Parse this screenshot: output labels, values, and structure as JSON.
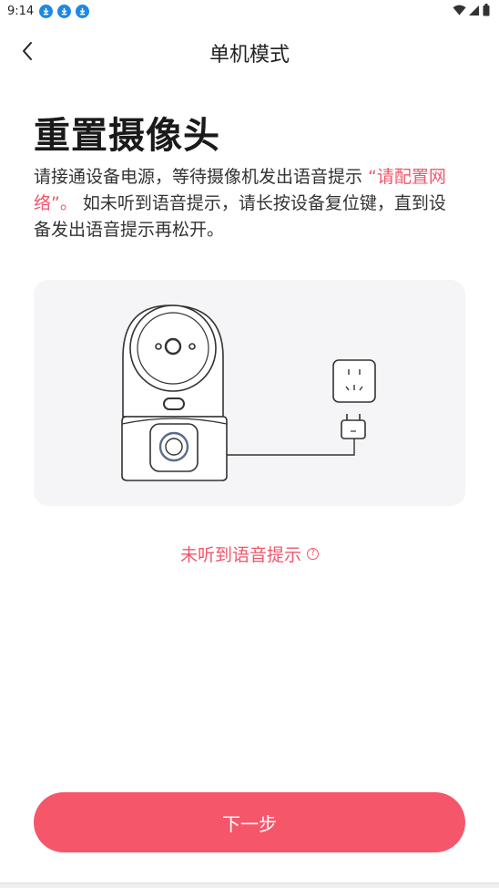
{
  "status_bar": {
    "time": "9:14",
    "notification_icons": [
      "download-icon",
      "download-icon",
      "download-icon"
    ],
    "right_icons": [
      "wifi-icon",
      "signal-icon",
      "battery-icon"
    ]
  },
  "header": {
    "title": "单机模式",
    "back_icon": "chevron-left-icon"
  },
  "content": {
    "main_title": "重置摄像头",
    "description_part1": "请接通设备电源，等待摄像机发出语音提示 ",
    "description_highlight": "“请配置网络”。",
    "description_part2": " 如未听到语音提示，请长按设备复位键，直到设备发出语音提示再松开。",
    "help_link": "未听到语音提示",
    "help_icon": "question-circle-icon"
  },
  "footer": {
    "next_button": "下一步"
  },
  "colors": {
    "accent": "#f5566a",
    "highlight_text": "#f0566a",
    "illustration_bg": "#f5f5f7"
  }
}
